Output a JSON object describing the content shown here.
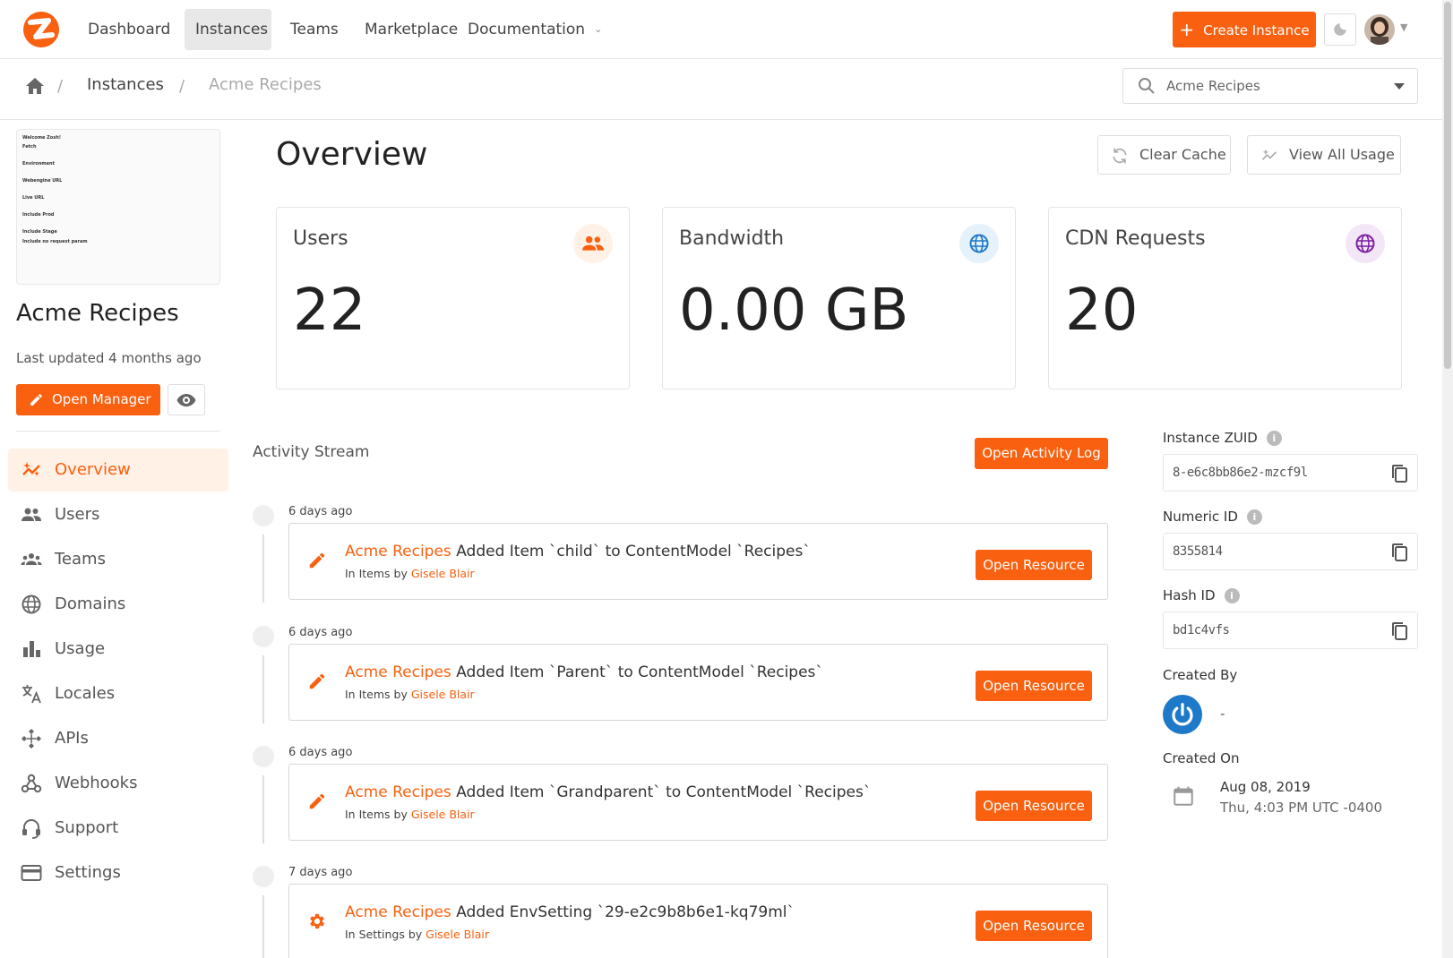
{
  "nav": {
    "items": [
      "Dashboard",
      "Instances",
      "Teams",
      "Marketplace",
      "Documentation"
    ],
    "create_label": "Create Instance"
  },
  "breadcrumb": {
    "instances": "Instances",
    "current": "Acme Recipes",
    "selector_value": "Acme Recipes"
  },
  "sidebar": {
    "thumb_lines": [
      "Welcome Zosh!",
      "Fetch",
      "Environment",
      "Webengine URL",
      "Live URL",
      "Include Prod",
      "Include Stage",
      "Include no request param"
    ],
    "instance_name": "Acme Recipes",
    "last_updated": "Last updated 4 months ago",
    "open_manager": "Open Manager",
    "items": [
      {
        "label": "Overview",
        "icon": "sparkle-icon"
      },
      {
        "label": "Users",
        "icon": "users-icon"
      },
      {
        "label": "Teams",
        "icon": "teams-icon"
      },
      {
        "label": "Domains",
        "icon": "globe-icon"
      },
      {
        "label": "Usage",
        "icon": "bar-chart-icon"
      },
      {
        "label": "Locales",
        "icon": "translate-icon"
      },
      {
        "label": "APIs",
        "icon": "api-icon"
      },
      {
        "label": "Webhooks",
        "icon": "webhook-icon"
      },
      {
        "label": "Support",
        "icon": "support-icon"
      },
      {
        "label": "Settings",
        "icon": "card-icon"
      }
    ]
  },
  "main": {
    "title": "Overview",
    "clear_cache": "Clear Cache",
    "view_usage": "View All Usage",
    "stats": [
      {
        "label": "Users",
        "value": "22",
        "icon": "users-icon",
        "color": "#f9600f",
        "bg": "#fff1e6"
      },
      {
        "label": "Bandwidth",
        "value": "0.00 GB",
        "icon": "globe-icon",
        "color": "#1e79c8",
        "bg": "#e6f2fb"
      },
      {
        "label": "CDN Requests",
        "value": "20",
        "icon": "globe-icon",
        "color": "#7b1fa2",
        "bg": "#f3e6f7"
      }
    ],
    "activity_title": "Activity Stream",
    "open_log": "Open Activity Log",
    "activities": [
      {
        "date": "6 days ago",
        "instance": "Acme Recipes",
        "action": " Added Item `child` to ContentModel `Recipes`",
        "context": "In Items by ",
        "user": "Gisele Blair",
        "button": "Open Resource",
        "icon": "pencil-icon"
      },
      {
        "date": "6 days ago",
        "instance": "Acme Recipes",
        "action": " Added Item `Parent` to ContentModel `Recipes`",
        "context": "In Items by ",
        "user": "Gisele Blair",
        "button": "Open Resource",
        "icon": "pencil-icon"
      },
      {
        "date": "6 days ago",
        "instance": "Acme Recipes",
        "action": " Added Item `Grandparent` to ContentModel `Recipes`",
        "context": "In Items by ",
        "user": "Gisele Blair",
        "button": "Open Resource",
        "icon": "pencil-icon"
      },
      {
        "date": "7 days ago",
        "instance": "Acme Recipes",
        "action": " Added EnvSetting `29-e2c9b8b6e1-kq79ml`",
        "context": "In Settings by ",
        "user": "Gisele Blair",
        "button": "Open Resource",
        "icon": "gear-icon"
      }
    ]
  },
  "details": {
    "zuid_label": "Instance ZUID",
    "zuid_value": "8-e6c8bb86e2-mzcf9l",
    "numeric_label": "Numeric ID",
    "numeric_value": "8355814",
    "hash_label": "Hash ID",
    "hash_value": "bd1c4vfs",
    "created_by_label": "Created By",
    "created_by_value": "-",
    "created_on_label": "Created On",
    "created_on_date": "Aug 08, 2019",
    "created_on_time": "Thu, 4:03 PM UTC -0400"
  },
  "colors": {
    "accent": "#f9600f",
    "accent_light": "#fff1e6",
    "blue": "#1e79c8"
  }
}
